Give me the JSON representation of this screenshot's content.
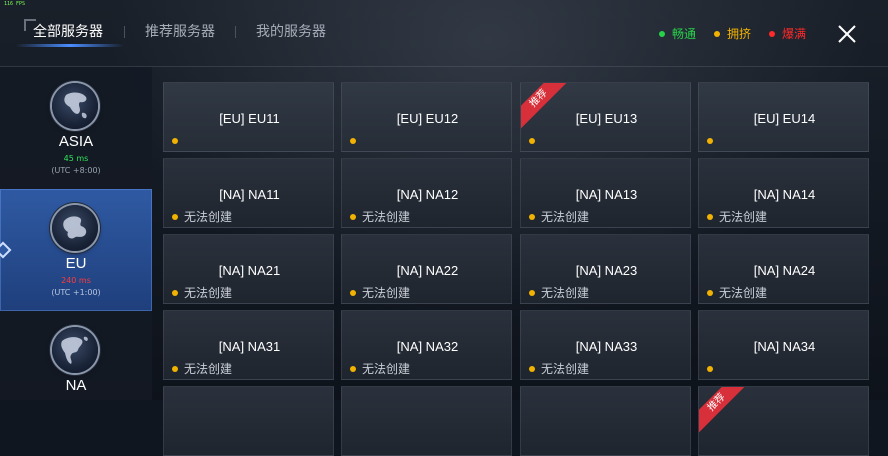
{
  "fps": "116 FPS",
  "tabs": [
    {
      "label": "全部服务器",
      "active": true
    },
    {
      "label": "推荐服务器",
      "active": false
    },
    {
      "label": "我的服务器",
      "active": false
    }
  ],
  "legend": [
    {
      "label": "畅通",
      "color": "#27d24a"
    },
    {
      "label": "拥挤",
      "color": "#f2b200"
    },
    {
      "label": "爆满",
      "color": "#ff2a2a"
    }
  ],
  "regions": [
    {
      "name": "ASIA",
      "ping": "45 ms",
      "ping_color": "#2ee35a",
      "utc": "(UTC +8:00)",
      "selected": false
    },
    {
      "name": "EU",
      "ping": "240 ms",
      "ping_color": "#ff3a3a",
      "utc": "(UTC +1:00)",
      "selected": true
    },
    {
      "name": "NA",
      "ping": "",
      "ping_color": "#2ee35a",
      "utc": "",
      "selected": false
    }
  ],
  "servers": [
    {
      "name": "[EU] EU11",
      "status": "",
      "recommended": false
    },
    {
      "name": "[EU] EU12",
      "status": "",
      "recommended": false
    },
    {
      "name": "[EU] EU13",
      "status": "",
      "recommended": true
    },
    {
      "name": "[EU] EU14",
      "status": "",
      "recommended": false
    },
    {
      "name": "[NA] NA11",
      "status": "无法创建",
      "recommended": false
    },
    {
      "name": "[NA] NA12",
      "status": "无法创建",
      "recommended": false
    },
    {
      "name": "[NA] NA13",
      "status": "无法创建",
      "recommended": false
    },
    {
      "name": "[NA] NA14",
      "status": "无法创建",
      "recommended": false
    },
    {
      "name": "[NA] NA21",
      "status": "无法创建",
      "recommended": false
    },
    {
      "name": "[NA] NA22",
      "status": "无法创建",
      "recommended": false
    },
    {
      "name": "[NA] NA23",
      "status": "无法创建",
      "recommended": false
    },
    {
      "name": "[NA] NA24",
      "status": "无法创建",
      "recommended": false
    },
    {
      "name": "[NA] NA31",
      "status": "无法创建",
      "recommended": false
    },
    {
      "name": "[NA] NA32",
      "status": "无法创建",
      "recommended": false
    },
    {
      "name": "[NA] NA33",
      "status": "无法创建",
      "recommended": false
    },
    {
      "name": "[NA] NA34",
      "status": "",
      "recommended": false
    },
    {
      "name": "",
      "status": "",
      "recommended": false
    },
    {
      "name": "",
      "status": "",
      "recommended": false
    },
    {
      "name": "",
      "status": "",
      "recommended": false
    },
    {
      "name": "",
      "status": "",
      "recommended": true
    }
  ],
  "ribbon_label": "推荐",
  "status_dot_color": "#f2b200"
}
